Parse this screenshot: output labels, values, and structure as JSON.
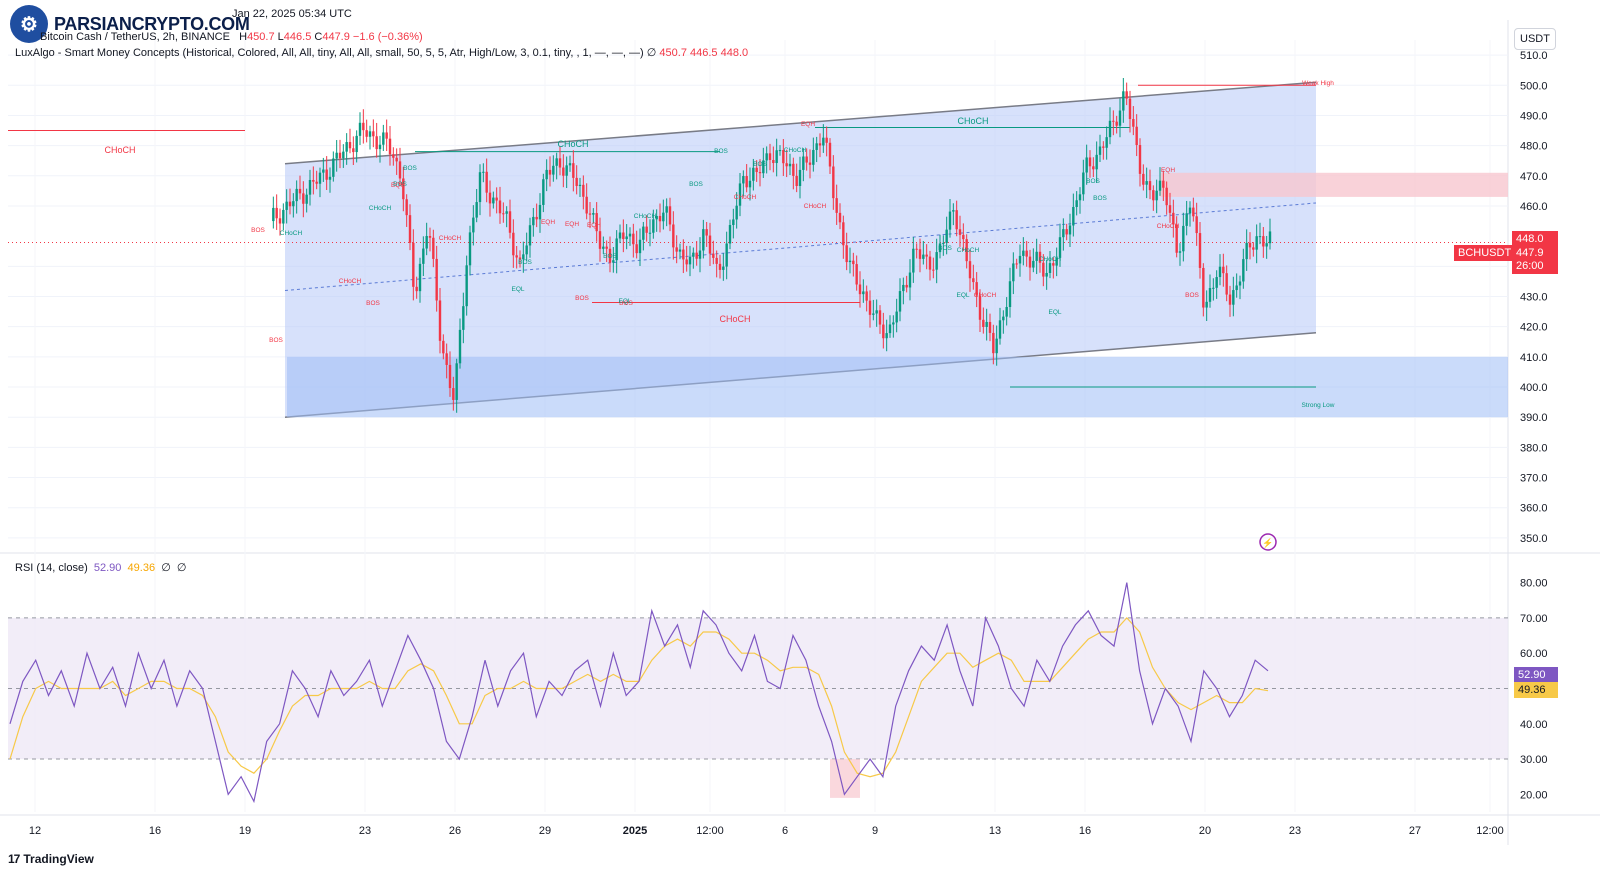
{
  "header": {
    "symbol_line": "Bitcoin Cash / TetherUS, 2h, BINANCE",
    "published": "Jan 22, 2025 05:34 UTC",
    "ohlc": {
      "h_label": "H",
      "h": "450.7",
      "l_label": "L",
      "l": "446.5",
      "c_label": "C",
      "c": "447.9",
      "change": "−1.6 (−0.36%)"
    },
    "indicator_line": "LuxAlgo - Smart Money Concepts (Historical, Colored, All, All, tiny, All, All, small, 50, 5, 5, Atr, High/Low, 3, 0.1, tiny, , 1, —, —, —)",
    "indicator_icon": "∅",
    "indicator_values": [
      "450.7",
      "446.5",
      "448.0"
    ]
  },
  "logo": {
    "text": "PARSIANCRYPTO.COM",
    "icon": "coins-logo-icon"
  },
  "currency_button": "USDT",
  "price_tags": {
    "top": "448.0",
    "symbol": "BCHUSDT",
    "last": "447.9",
    "countdown": "26:00"
  },
  "rsi_header": {
    "label": "RSI (14, close)",
    "rsi": "52.90",
    "ma": "49.36",
    "icons": [
      "∅",
      "∅"
    ]
  },
  "rsi_tags": {
    "rsi": "52.90",
    "ma": "49.36"
  },
  "brand": {
    "mark": "17",
    "text": "TradingView"
  },
  "colors": {
    "up": "#089981",
    "down": "#f23645",
    "channel_fill": "#b6c9f7",
    "rsi_line": "#7e57c2",
    "rsi_ma": "#f7c948",
    "rsi_band": "#ede7f6"
  },
  "chart_data": [
    {
      "type": "candlestick",
      "title": "",
      "ylim": [
        345,
        515
      ],
      "y_ticks": [
        350,
        360,
        370,
        380,
        390,
        400,
        410,
        420,
        430,
        440,
        460,
        470,
        480,
        490,
        500,
        510
      ],
      "y_tick_labels": [
        "350.0",
        "360.0",
        "370.0",
        "380.0",
        "390.0",
        "400.0",
        "410.0",
        "420.0",
        "430.0",
        "440.0",
        "460.0",
        "470.0",
        "480.0",
        "490.0",
        "500.0",
        "510.0"
      ],
      "x_tick_labels": [
        "12",
        "16",
        "19",
        "23",
        "26",
        "29",
        "2025",
        "12:00",
        "6",
        "9",
        "13",
        "16",
        "20",
        "23",
        "27",
        "12:00"
      ],
      "close_path": [
        [
          0,
          455
        ],
        [
          4,
          470
        ],
        [
          7,
          485
        ],
        [
          9,
          480
        ],
        [
          10,
          470
        ],
        [
          11,
          430
        ],
        [
          12,
          455
        ],
        [
          13,
          415
        ],
        [
          14,
          395
        ],
        [
          15,
          445
        ],
        [
          16,
          470
        ],
        [
          17,
          462
        ],
        [
          18,
          455
        ],
        [
          19,
          440
        ],
        [
          20,
          455
        ],
        [
          21,
          470
        ],
        [
          22,
          475
        ],
        [
          23,
          470
        ],
        [
          24,
          462
        ],
        [
          25,
          448
        ],
        [
          26,
          443
        ],
        [
          27,
          452
        ],
        [
          28,
          446
        ],
        [
          29,
          455
        ],
        [
          30,
          458
        ],
        [
          31,
          445
        ],
        [
          32,
          440
        ],
        [
          33,
          452
        ],
        [
          34,
          437
        ],
        [
          35,
          452
        ],
        [
          36,
          470
        ],
        [
          37,
          470
        ],
        [
          38,
          478
        ],
        [
          39,
          475
        ],
        [
          40,
          470
        ],
        [
          41,
          475
        ],
        [
          42,
          485
        ],
        [
          43,
          460
        ],
        [
          44,
          440
        ],
        [
          45,
          432
        ],
        [
          46,
          422
        ],
        [
          47,
          418
        ],
        [
          48,
          430
        ],
        [
          49,
          446
        ],
        [
          50,
          440
        ],
        [
          51,
          446
        ],
        [
          52,
          460
        ],
        [
          53,
          440
        ],
        [
          54,
          425
        ],
        [
          55,
          412
        ],
        [
          56,
          430
        ],
        [
          57,
          445
        ],
        [
          58,
          442
        ],
        [
          59,
          438
        ],
        [
          60,
          446
        ],
        [
          61,
          458
        ],
        [
          62,
          472
        ],
        [
          63,
          478
        ],
        [
          64,
          486
        ],
        [
          65,
          498
        ],
        [
          66,
          475
        ],
        [
          67,
          462
        ],
        [
          68,
          468
        ],
        [
          69,
          442
        ],
        [
          70,
          465
        ],
        [
          71,
          425
        ],
        [
          72,
          440
        ],
        [
          73,
          428
        ],
        [
          74,
          442
        ],
        [
          75,
          450
        ],
        [
          76,
          447.9
        ]
      ],
      "annotations": {
        "choch": [
          "CHoCH",
          "CHoCH",
          "CHoCH",
          "CHoCH",
          "CHoCH",
          "CHoCH",
          "CHoCH",
          "CHoCH",
          "CHoCH",
          "CHoCH",
          "CHoCH",
          "CHoCH",
          "CHoCH",
          "CHoCH",
          "CHoCH",
          "CHoCH"
        ],
        "bos": [
          "BOS",
          "BOS",
          "BOS",
          "BOS",
          "BOS",
          "BOS",
          "BOS",
          "BOS",
          "BOS",
          "BOS",
          "BOS",
          "BOS",
          "BOS",
          "BOS",
          "BOS",
          "BOS"
        ],
        "eqh": [
          "EQH",
          "EQH",
          "EQH",
          "EQH",
          "EQH",
          "EQH"
        ],
        "eql": [
          "EQL",
          "EQL",
          "EQL",
          "EQL"
        ],
        "levels": [
          "Weak High",
          "Strong Low"
        ]
      },
      "channel": {
        "upper": [
          [
            13.5,
            474
          ],
          [
            75,
            501
          ]
        ],
        "lower": [
          [
            13.5,
            390
          ],
          [
            75,
            418
          ]
        ]
      }
    },
    {
      "type": "line",
      "title": "",
      "ylim": [
        15,
        83
      ],
      "y_ticks": [
        20,
        30,
        40,
        50,
        60,
        70,
        80
      ],
      "y_tick_labels": [
        "20.00",
        "30.00",
        "40.00",
        "50.00",
        "60.00",
        "70.00",
        "80.00"
      ],
      "bands": {
        "upper": 70,
        "middle": 50,
        "lower": 30
      },
      "series": [
        {
          "name": "RSI",
          "values": [
            40,
            52,
            58,
            48,
            55,
            45,
            60,
            50,
            56,
            45,
            60,
            50,
            58,
            45,
            55,
            50,
            35,
            20,
            25,
            18,
            35,
            40,
            55,
            50,
            42,
            55,
            48,
            52,
            58,
            45,
            55,
            65,
            58,
            50,
            35,
            30,
            42,
            58,
            45,
            55,
            60,
            42,
            52,
            48,
            55,
            58,
            45,
            60,
            48,
            52,
            72,
            62,
            68,
            56,
            72,
            68,
            60,
            55,
            65,
            52,
            50,
            65,
            58,
            45,
            35,
            20,
            25,
            30,
            25,
            45,
            55,
            62,
            58,
            68,
            55,
            45,
            70,
            62,
            50,
            45,
            58,
            52,
            62,
            68,
            72,
            65,
            62,
            80,
            55,
            40,
            50,
            45,
            35,
            55,
            50,
            42,
            48,
            58,
            55
          ]
        },
        {
          "name": "MA",
          "values": [
            30,
            42,
            50,
            52,
            50,
            50,
            50,
            50,
            52,
            48,
            50,
            52,
            52,
            50,
            50,
            48,
            42,
            32,
            28,
            26,
            30,
            38,
            45,
            48,
            48,
            50,
            50,
            50,
            52,
            50,
            50,
            55,
            57,
            55,
            48,
            40,
            40,
            48,
            50,
            50,
            52,
            50,
            50,
            50,
            52,
            54,
            52,
            54,
            52,
            52,
            58,
            62,
            64,
            62,
            66,
            66,
            64,
            60,
            60,
            58,
            55,
            56,
            56,
            54,
            45,
            32,
            26,
            25,
            26,
            32,
            42,
            52,
            56,
            60,
            60,
            56,
            58,
            60,
            58,
            52,
            52,
            52,
            56,
            60,
            64,
            66,
            66,
            70,
            66,
            56,
            50,
            46,
            44,
            46,
            48,
            46,
            46,
            50,
            49.36
          ]
        }
      ]
    }
  ]
}
